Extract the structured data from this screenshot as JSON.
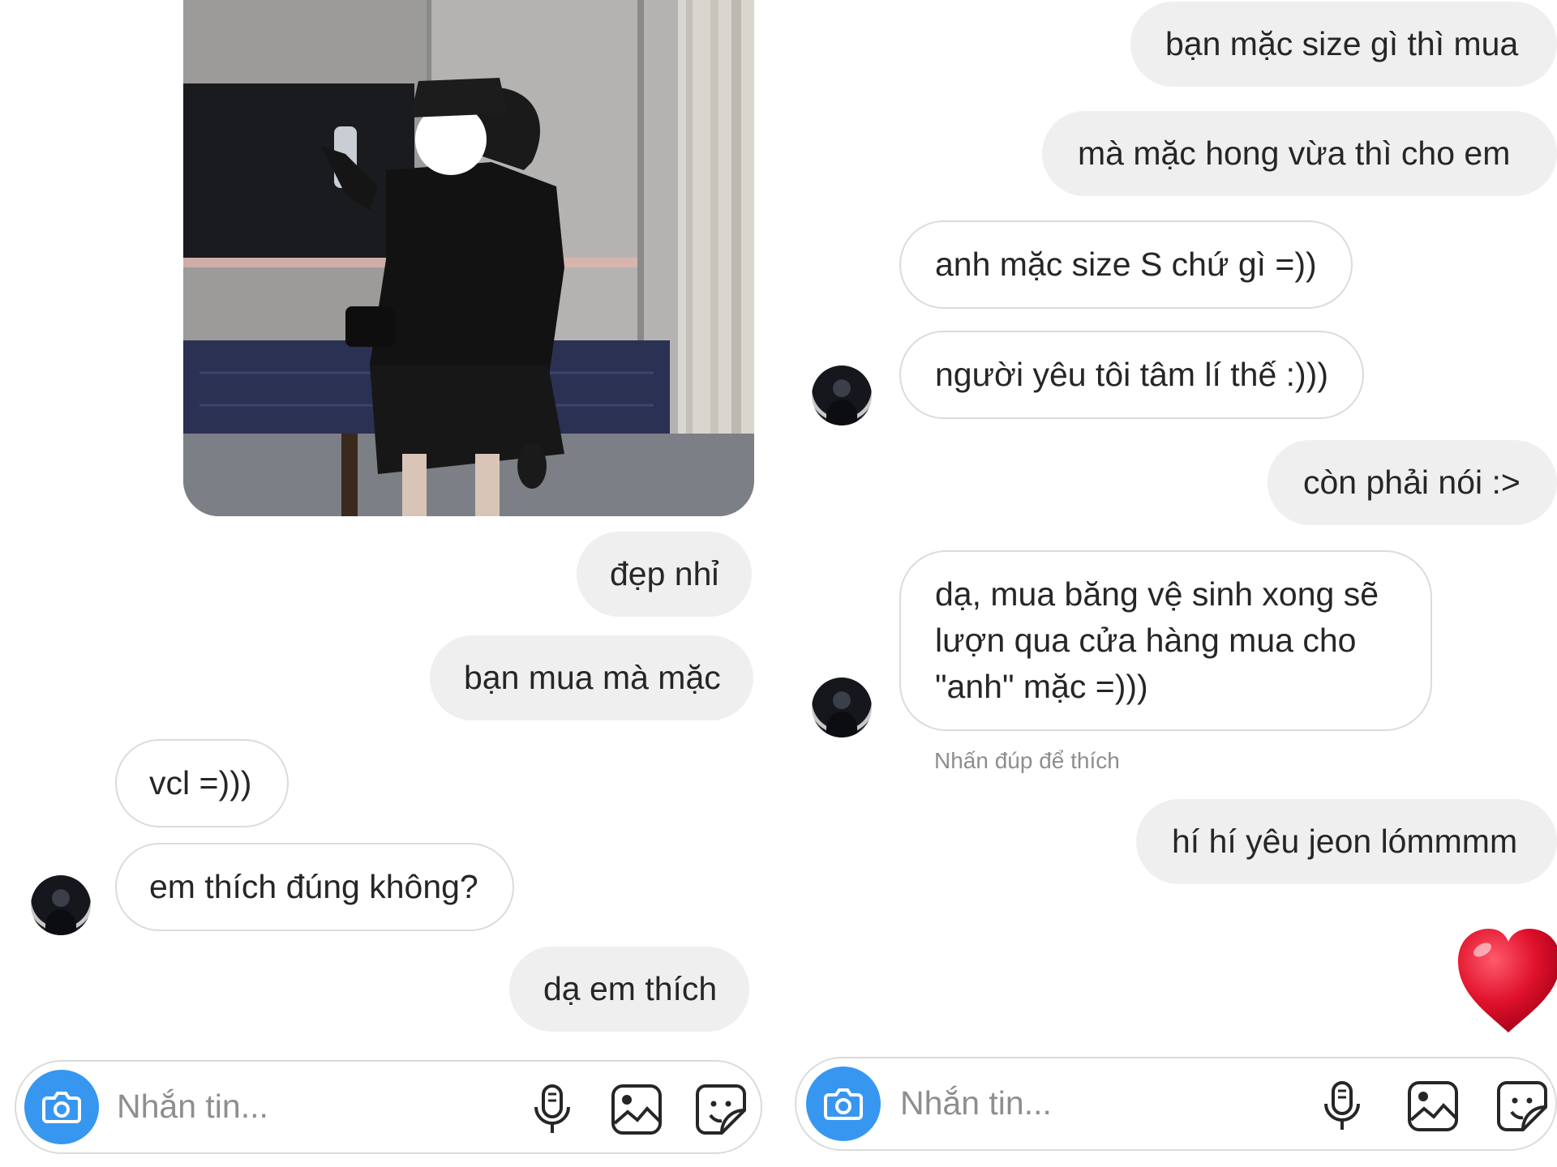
{
  "left": {
    "messages": [
      {
        "text": "đẹp nhỉ",
        "side": "out"
      },
      {
        "text": "bạn mua mà mặc",
        "side": "out"
      },
      {
        "text": "vcl =)))",
        "side": "in"
      },
      {
        "text": "em thích đúng không?",
        "side": "in"
      },
      {
        "text": "dạ em thích",
        "side": "out"
      }
    ],
    "composer": {
      "placeholder": "Nhắn tin..."
    }
  },
  "right": {
    "messages": [
      {
        "text": "bạn mặc size gì thì mua",
        "side": "out"
      },
      {
        "text": "mà mặc hong vừa thì cho em",
        "side": "out"
      },
      {
        "text": "anh mặc size S chứ gì =))",
        "side": "in"
      },
      {
        "text": "người yêu tôi tâm lí thế :)))",
        "side": "in"
      },
      {
        "text": "còn phải nói :>",
        "side": "out"
      },
      {
        "text": "dạ, mua băng vệ sinh xong sẽ lượn qua cửa hàng mua cho \"anh\" mặc =)))",
        "side": "in"
      },
      {
        "text": "hí hí yêu jeon lómmmm",
        "side": "out"
      }
    ],
    "hint": "Nhấn đúp để thích",
    "reaction": "heart-emoji",
    "composer": {
      "placeholder": "Nhắn tin..."
    }
  },
  "icons": [
    "camera-icon",
    "microphone-icon",
    "gallery-icon",
    "sticker-icon"
  ],
  "colors": {
    "outgoing_bubble": "#efefef",
    "incoming_border": "#dbdbdb",
    "camera_button": "#3797f0",
    "heart": "#e0112b"
  }
}
